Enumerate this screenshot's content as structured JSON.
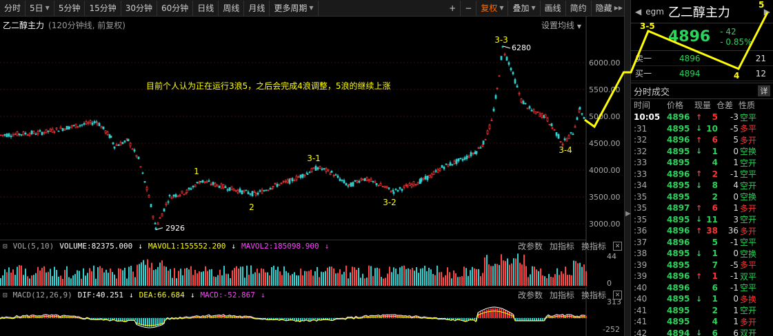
{
  "toolbar": {
    "periods": [
      "分时",
      "5日",
      "5分钟",
      "15分钟",
      "30分钟",
      "60分钟",
      "日线",
      "周线",
      "月线",
      "更多周期"
    ],
    "right": [
      "+",
      "−",
      "复权",
      "叠加",
      "画线",
      "简约",
      "隐藏"
    ]
  },
  "main": {
    "title": "乙二醇主力",
    "subtitle": "(120分钟线, 前复权)",
    "set_ma": "设置均线",
    "annotation": "目前个人认为正在运行3浪5，之后会完成4浪调整，5浪的继续上涨",
    "y_labels": [
      "6000.00",
      "5500.00",
      "5000.00",
      "4500.00",
      "4000.00",
      "3500.00",
      "3000.00"
    ],
    "high_label": "6280",
    "low_label": "2926",
    "waves": [
      "1",
      "2",
      "3-1",
      "3-2",
      "3-3",
      "3-4",
      "3-5",
      "4",
      "5"
    ]
  },
  "vol_panel": {
    "name": "VOL(5,10)",
    "volume": "VOLUME:82375.000",
    "ma1": "MAVOL1:155552.200",
    "ma2": "MAVOL2:185098.900",
    "y_top": "44",
    "y_bottom": "0"
  },
  "macd_panel": {
    "name": "MACD(12,26,9)",
    "dif": "DIF:40.251",
    "dea": "DEA:66.684",
    "macd": "MACD:-52.867",
    "y_top": "313",
    "y_bottom": "-252"
  },
  "panel_links": [
    "改参数",
    "加指标",
    "换指标"
  ],
  "right": {
    "code": "egm",
    "name": "乙二醇主力",
    "price": "4896",
    "change": "- 42",
    "pct": "- 0.85%",
    "sell1": {
      "label": "卖一",
      "price": "4896",
      "vol": "21"
    },
    "buy1": {
      "label": "买一",
      "price": "4894",
      "vol": "12"
    },
    "ticks_title": "分时成交",
    "detail_btn": "详",
    "headers": [
      "时间",
      "价格",
      "现量",
      "仓差",
      "性质"
    ],
    "ticks": [
      {
        "t": "10:05",
        "p": "4896",
        "d": "up",
        "v": "5",
        "oi": "-3",
        "n": "空平"
      },
      {
        "t": ":31",
        "p": "4895",
        "d": "dn",
        "v": "10",
        "oi": "-5",
        "n": "多平"
      },
      {
        "t": ":32",
        "p": "4896",
        "d": "up",
        "v": "6",
        "oi": "5",
        "n": "多开"
      },
      {
        "t": ":32",
        "p": "4895",
        "d": "dn",
        "v": "1",
        "oi": "0",
        "n": "空换"
      },
      {
        "t": ":33",
        "p": "4895",
        "d": "",
        "v": "4",
        "oi": "1",
        "n": "空开"
      },
      {
        "t": ":33",
        "p": "4896",
        "d": "up",
        "v": "2",
        "oi": "-1",
        "n": "空平"
      },
      {
        "t": ":34",
        "p": "4895",
        "d": "dn",
        "v": "8",
        "oi": "4",
        "n": "空开"
      },
      {
        "t": ":35",
        "p": "4895",
        "d": "",
        "v": "2",
        "oi": "0",
        "n": "空换"
      },
      {
        "t": ":35",
        "p": "4897",
        "d": "up",
        "v": "6",
        "oi": "1",
        "n": "多开"
      },
      {
        "t": ":35",
        "p": "4895",
        "d": "dn",
        "v": "11",
        "oi": "3",
        "n": "空开"
      },
      {
        "t": ":36",
        "p": "4896",
        "d": "up",
        "v": "38",
        "oi": "36",
        "n": "多开"
      },
      {
        "t": ":37",
        "p": "4896",
        "d": "",
        "v": "5",
        "oi": "-1",
        "n": "空平"
      },
      {
        "t": ":38",
        "p": "4895",
        "d": "dn",
        "v": "1",
        "oi": "0",
        "n": "空换"
      },
      {
        "t": ":39",
        "p": "4895",
        "d": "",
        "v": "7",
        "oi": "-5",
        "n": "多平"
      },
      {
        "t": ":39",
        "p": "4896",
        "d": "up",
        "v": "1",
        "oi": "-1",
        "n": "双平"
      },
      {
        "t": ":40",
        "p": "4896",
        "d": "",
        "v": "6",
        "oi": "-1",
        "n": "空平"
      },
      {
        "t": ":40",
        "p": "4895",
        "d": "dn",
        "v": "1",
        "oi": "0",
        "n": "多换"
      },
      {
        "t": ":41",
        "p": "4895",
        "d": "",
        "v": "2",
        "oi": "1",
        "n": "空开"
      },
      {
        "t": ":41",
        "p": "4895",
        "d": "",
        "v": "4",
        "oi": "1",
        "n": "多开"
      },
      {
        "t": ":42",
        "p": "4894",
        "d": "dn",
        "v": "6",
        "oi": "6",
        "n": "双开"
      }
    ]
  }
}
